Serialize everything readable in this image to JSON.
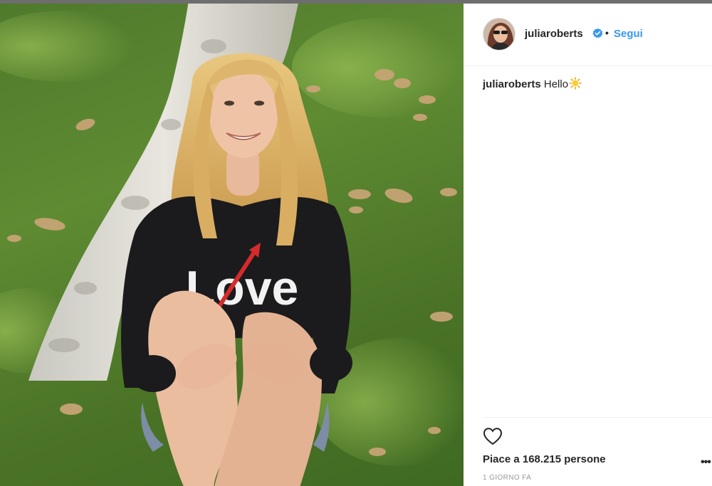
{
  "post": {
    "author": {
      "username": "juliaroberts",
      "verified": true,
      "separator": "•",
      "follow_label": "Segui"
    },
    "caption": {
      "username": "juliaroberts",
      "text": "Hello",
      "emoji": "sun-emoji"
    },
    "photo": {
      "sweater_text": "Love"
    },
    "likes_text": "Piace a 168.215 persone",
    "timestamp": "1 GIORNO FA",
    "more_label": "•••"
  },
  "colors": {
    "link_blue": "#3897f0",
    "verified_blue": "#3897f0",
    "text": "#262626",
    "muted": "#999999"
  },
  "icons": [
    "verified-badge-icon",
    "heart-icon",
    "sun-emoji",
    "more-options-icon"
  ]
}
